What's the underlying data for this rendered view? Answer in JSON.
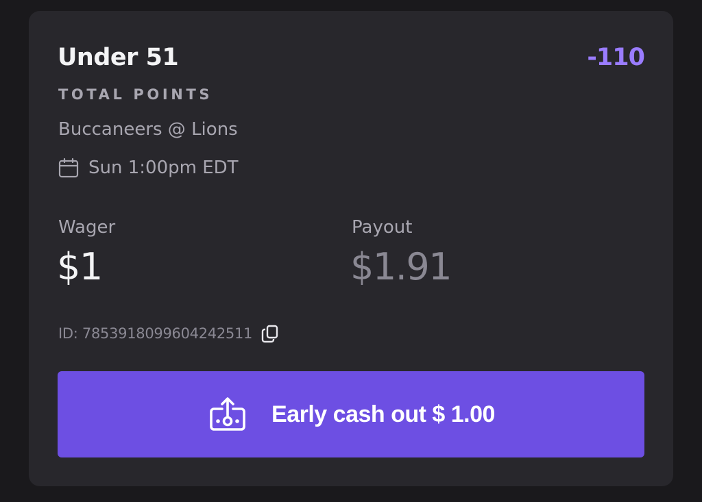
{
  "bet": {
    "selection": "Under 51",
    "odds": "-110",
    "market": "TOTAL POINTS",
    "matchup": "Buccaneers @ Lions",
    "datetime": "Sun 1:00pm EDT",
    "wager_label": "Wager",
    "wager_value": "$1",
    "payout_label": "Payout",
    "payout_value": "$1.91",
    "id_text": "ID: 7853918099604242511"
  },
  "cashout": {
    "label": "Early cash out $ 1.00"
  },
  "icons": {
    "calendar": "calendar-icon",
    "copy": "copy-icon",
    "cashout": "cash-out-icon"
  },
  "colors": {
    "background": "#1a191c",
    "card": "#28272c",
    "accent": "#6d4fe3",
    "odds": "#9a7cff",
    "primary_text": "#f4f4f6",
    "secondary_text": "#a8a6b0"
  }
}
